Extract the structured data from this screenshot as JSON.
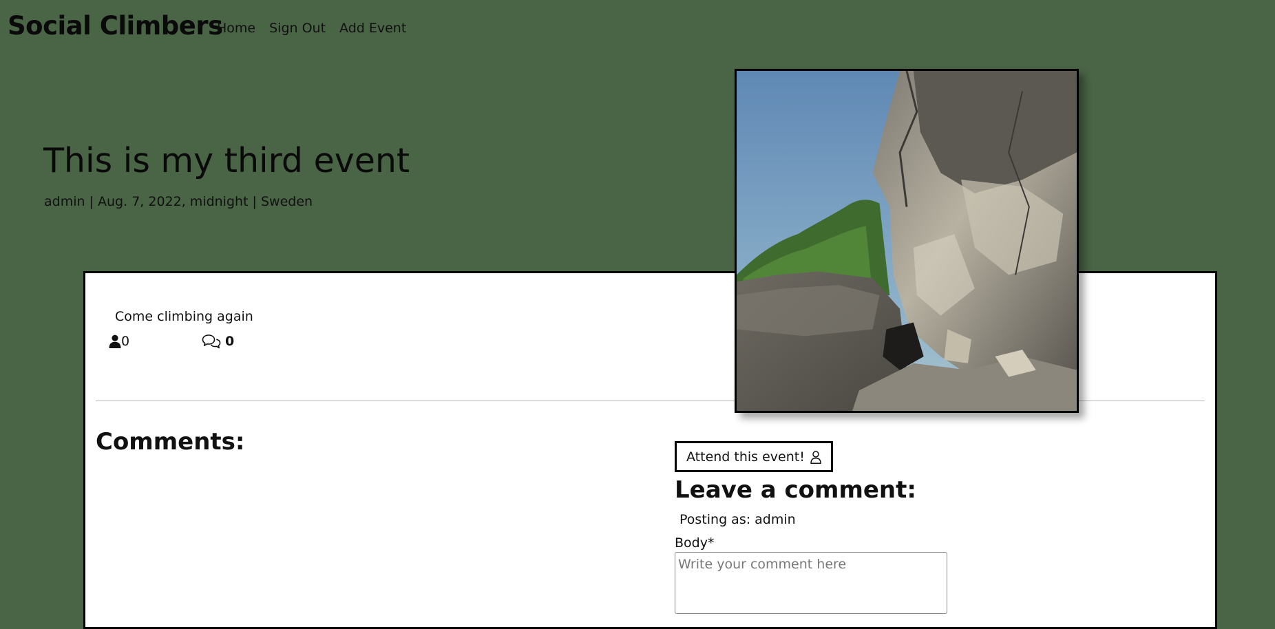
{
  "navbar": {
    "brand": "Social Climbers",
    "links": [
      "Home",
      "Sign Out",
      "Add Event"
    ]
  },
  "event": {
    "title": "This is my third event",
    "meta": "admin | Aug. 7, 2022, midnight | Sweden",
    "description": "Come climbing again",
    "attendee_count": "0",
    "comment_count": "0",
    "image": "climbing crag photo"
  },
  "comments": {
    "heading": "Comments:"
  },
  "form": {
    "attend_label": "Attend this event!",
    "leave_heading": "Leave a comment:",
    "posting_as": "Posting as: admin",
    "body_label": "Body*",
    "body_placeholder": "Write your comment here"
  },
  "icons": {
    "attendees": "person-icon",
    "comments": "chat-bubbles-icon",
    "attend": "person-outline-icon"
  },
  "colors": {
    "background": "#4a6446",
    "card": "#ffffff",
    "border": "#000000"
  }
}
